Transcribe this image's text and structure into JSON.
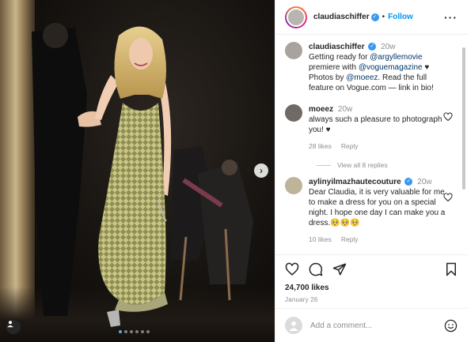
{
  "post": {
    "author": "claudiaschiffer",
    "follow_label": "Follow",
    "follow_separator": "•",
    "more_label": "···",
    "caption_time": "20w",
    "caption": {
      "pre": "Getting ready for ",
      "mention1": "@argyllemovie",
      "mid1": " premiere with ",
      "mention2": "@voguemagazine",
      "mid2": " ♥ Photos by ",
      "mention3": "@moeez",
      "post": ". Read the full feature on Vogue.com — link in bio!"
    },
    "likes": "24,700 likes",
    "date": "January 26",
    "add_comment_placeholder": "Add a comment...",
    "image": {
      "slide_count": 6,
      "active_slide": 1
    }
  },
  "comments": [
    {
      "username": "moeez",
      "time": "20w",
      "text": "always such a pleasure to photograph you! ♥",
      "likes": "28 likes",
      "reply_label": "Reply",
      "view_replies": "View all 8 replies"
    },
    {
      "username": "aylinyilmazhautecouture",
      "time": "20w",
      "text": "Dear Claudia, it is very valuable for me to make a dress for you on a special night. I hope one day I can make you a dress.🥺🥺🥺",
      "likes": "10 likes",
      "reply_label": "Reply"
    }
  ],
  "icons": {
    "verified": "✓",
    "next": "›",
    "tag": "person-icon"
  },
  "colors": {
    "accent": "#0095f6",
    "verified": "#3897f0",
    "muted": "#8e8e8e",
    "link": "#00376b"
  }
}
